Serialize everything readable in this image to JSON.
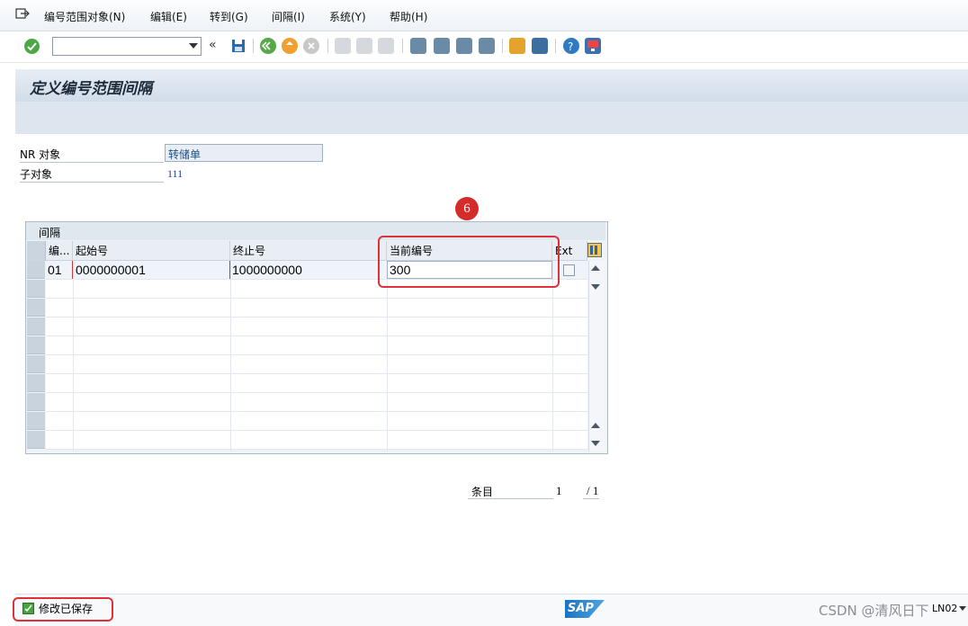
{
  "menu": {
    "items": [
      "编号范围对象(N)",
      "编辑(E)",
      "转到(G)",
      "间隔(I)",
      "系统(Y)",
      "帮助(H)"
    ]
  },
  "toolbar": {
    "command_field": "",
    "nav_back_symbol": "«"
  },
  "page": {
    "title": "定义编号范围间隔"
  },
  "fields": {
    "nr_object_label": "NR 对象",
    "nr_object_value": "转储单",
    "subobject_label": "子对象",
    "subobject_value": "111"
  },
  "annotation": {
    "badge": "6"
  },
  "table": {
    "title": "间隔",
    "columns": [
      "编...",
      "起始号",
      "终止号",
      "当前编号",
      "Ext"
    ],
    "rows": [
      {
        "no": "01",
        "from": "0000000001",
        "to": "1000000000",
        "current": "300",
        "ext": false
      }
    ]
  },
  "paging": {
    "label": "条目",
    "current": "1",
    "total": "/ 1"
  },
  "status": {
    "message": "修改已保存",
    "sap_logo": "SAP",
    "watermark": "CSDN @清风日下",
    "system": "LN02"
  },
  "colors": {
    "accent_red": "#e0303a",
    "title_band": "#d2dde9"
  }
}
